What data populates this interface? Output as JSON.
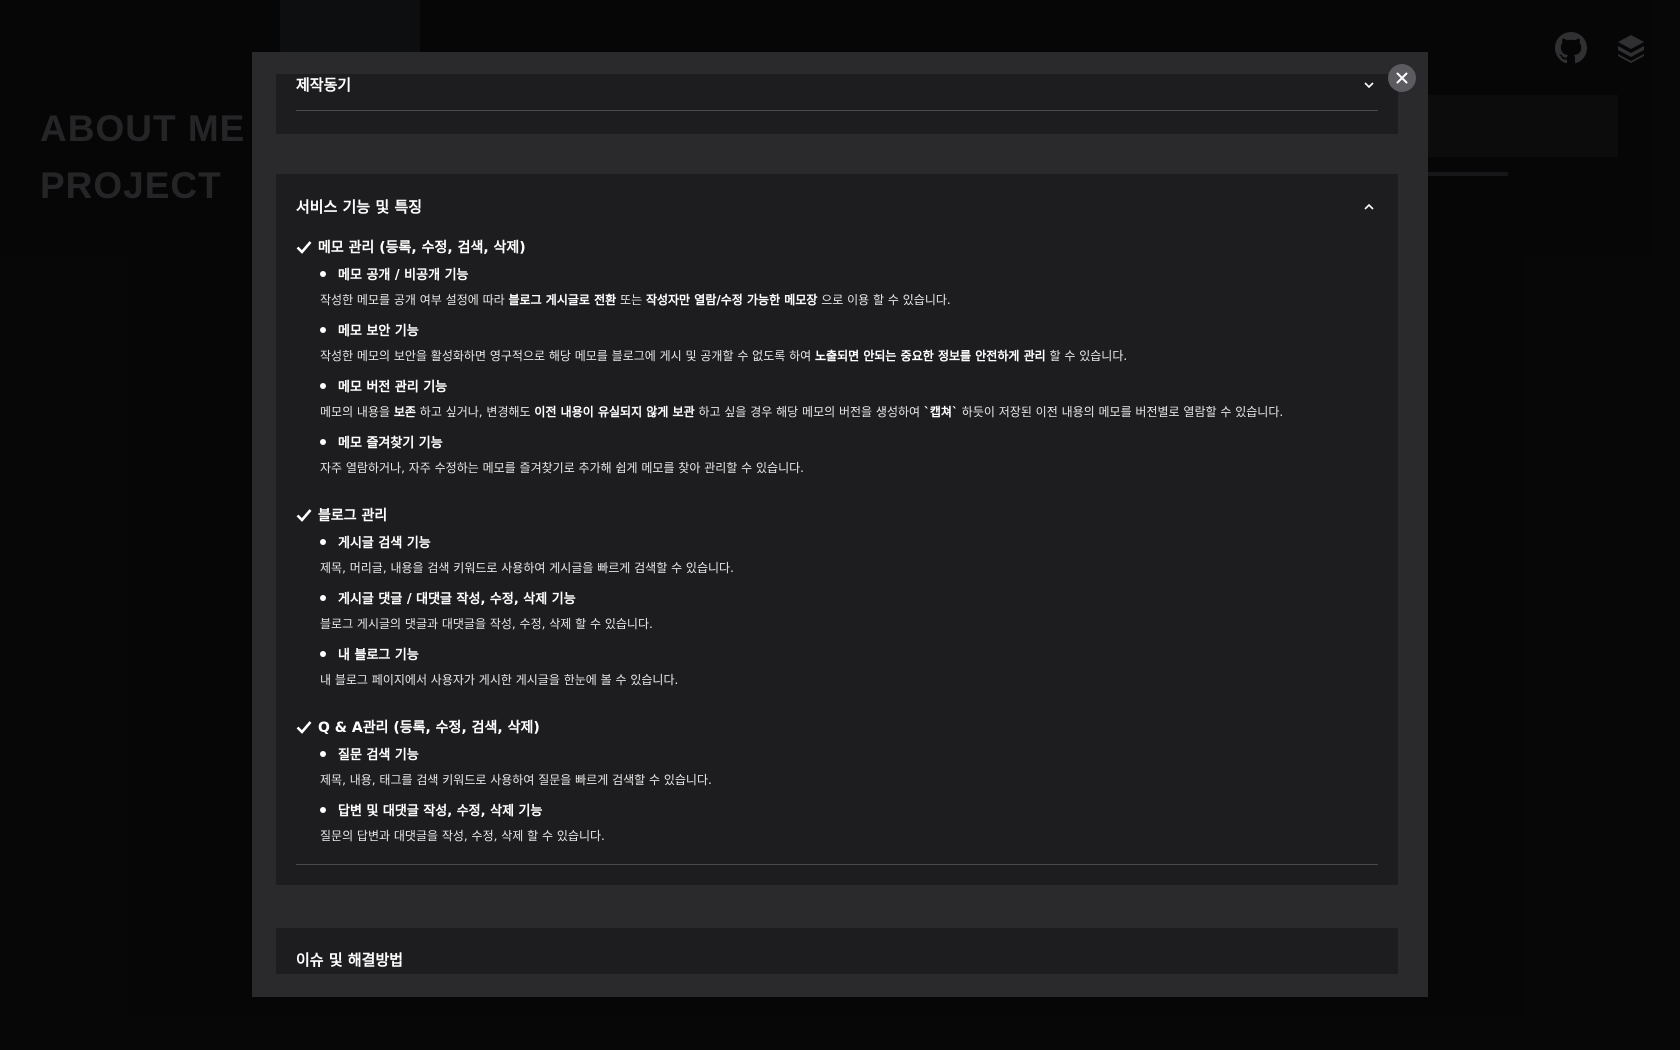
{
  "background": {
    "nav": [
      "ABOUT ME",
      "PROJECT"
    ],
    "icons": [
      "github-icon",
      "velog-icon"
    ]
  },
  "modal": {
    "close_icon": "close-icon",
    "sections": [
      {
        "title": "제작동기",
        "state": "collapsed"
      },
      {
        "title": "서비스 기능 및 특징",
        "state": "expanded",
        "groups": [
          {
            "title": "메모 관리 (등록, 수정, 검색, 삭제)",
            "items": [
              {
                "title": "메모 공개 / 비공개 기능",
                "desc": [
                  {
                    "t": "작성한 메모를 공개 여부 설정에 따라 "
                  },
                  {
                    "t": "블로그 게시글로 전환",
                    "b": true
                  },
                  {
                    "t": " 또는 "
                  },
                  {
                    "t": "작성자만 열람/수정 가능한 메모장",
                    "b": true
                  },
                  {
                    "t": " 으로 이용 할 수 있습니다."
                  }
                ]
              },
              {
                "title": "메모 보안 기능",
                "desc": [
                  {
                    "t": "작성한 메모의 보안을 활성화하면 영구적으로 해당 메모를 블로그에 게시 및 공개할 수 없도록 하여 "
                  },
                  {
                    "t": "노출되면 안되는 중요한 정보를 안전하게 관리",
                    "b": true
                  },
                  {
                    "t": " 할 수 있습니다."
                  }
                ]
              },
              {
                "title": "메모 버전 관리 기능",
                "desc": [
                  {
                    "t": "메모의 내용을 "
                  },
                  {
                    "t": "보존",
                    "b": true
                  },
                  {
                    "t": " 하고 싶거나, 변경해도 "
                  },
                  {
                    "t": "이전 내용이 유실되지 않게 보관",
                    "b": true
                  },
                  {
                    "t": " 하고 싶을 경우 해당 메모의 버전을 생성하여 "
                  },
                  {
                    "t": "`캡쳐`",
                    "b": true
                  },
                  {
                    "t": " 하듯이 저장된 이전 내용의 메모를 버전별로 열람할 수 있습니다."
                  }
                ]
              },
              {
                "title": "메모 즐겨찾기 기능",
                "desc": [
                  {
                    "t": "자주 열람하거나, 자주 수정하는 메모를 즐겨찾기로 추가해 쉽게 메모를 찾아 관리할 수 있습니다."
                  }
                ]
              }
            ]
          },
          {
            "title": "블로그 관리",
            "items": [
              {
                "title": "게시글 검색 기능",
                "desc": [
                  {
                    "t": "제목, 머리글, 내용을 검색 키워드로 사용하여 게시글을 빠르게 검색할 수 있습니다."
                  }
                ]
              },
              {
                "title": "게시글 댓글 / 대댓글 작성, 수정, 삭제 기능",
                "desc": [
                  {
                    "t": "블로그 게시글의 댓글과 대댓글을 작성, 수정, 삭제 할 수 있습니다."
                  }
                ]
              },
              {
                "title": "내 블로그 기능",
                "desc": [
                  {
                    "t": "내 블로그 페이지에서 사용자가 게시한 게시글을 한눈에 볼 수 있습니다."
                  }
                ]
              }
            ]
          },
          {
            "title": "Q & A관리 (등록, 수정, 검색, 삭제)",
            "items": [
              {
                "title": "질문 검색 기능",
                "desc": [
                  {
                    "t": "제목, 내용, 태그를 검색 키워드로 사용하여 질문을 빠르게 검색할 수 있습니다."
                  }
                ]
              },
              {
                "title": "답변 및 대댓글 작성, 수정, 삭제 기능",
                "desc": [
                  {
                    "t": "질문의 답변과 대댓글을 작성, 수정, 삭제 할 수 있습니다."
                  }
                ]
              }
            ]
          }
        ]
      },
      {
        "title": "이슈 및 해결방법",
        "state": "collapsed"
      }
    ]
  }
}
